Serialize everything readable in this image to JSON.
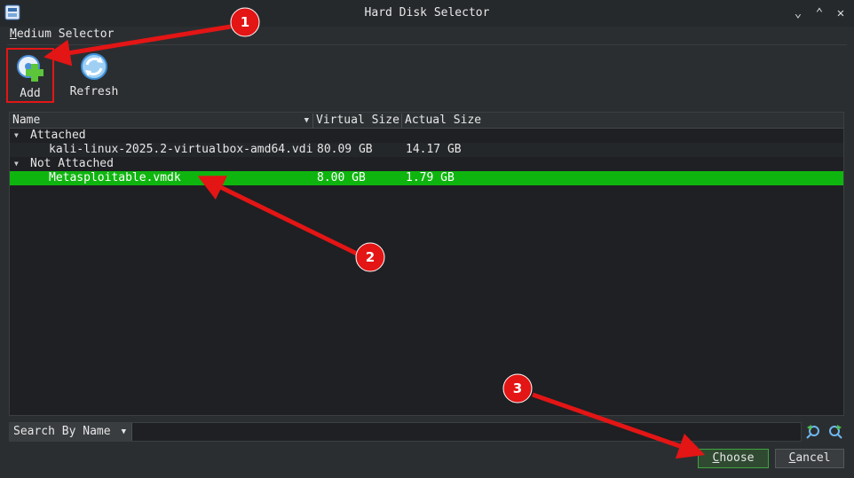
{
  "window": {
    "title": "Hard Disk Selector"
  },
  "menu": {
    "label_u": "M",
    "label_rest": "edium Selector"
  },
  "toolbar": {
    "add_label": "Add",
    "refresh_label": "Refresh"
  },
  "table": {
    "headers": {
      "name": "Name",
      "virtual": "Virtual Size",
      "actual": "Actual Size"
    },
    "groups": [
      {
        "label": "Attached",
        "items": [
          {
            "name": "kali-linux-2025.2-virtualbox-amd64.vdi",
            "virtual": "80.09 GB",
            "actual": "14.17 GB"
          }
        ]
      },
      {
        "label": "Not Attached",
        "items": [
          {
            "name": "Metasploitable.vmdk",
            "virtual": "8.00 GB",
            "actual": "1.79 GB",
            "selected": true
          }
        ]
      }
    ]
  },
  "search": {
    "mode": "Search By Name",
    "value": ""
  },
  "buttons": {
    "choose_u": "C",
    "choose_rest": "hoose",
    "cancel_u": "C",
    "cancel_rest": "ancel"
  },
  "annotations": [
    "1",
    "2",
    "3"
  ],
  "colors": {
    "selection": "#0fb50f",
    "highlight": "#e31515"
  }
}
